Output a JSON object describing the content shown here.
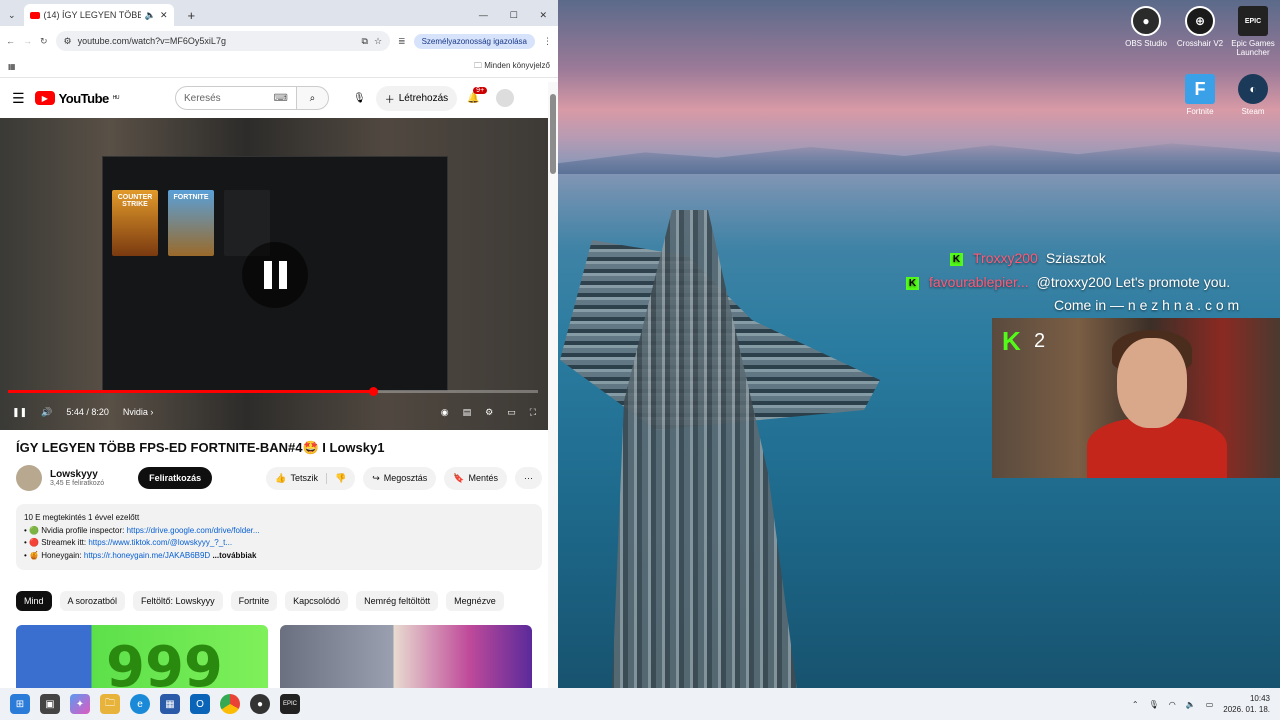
{
  "browser": {
    "tab_title": "(14) ÍGY LEGYEN TÖBB FPS-...",
    "url": "youtube.com/watch?v=MF6Oy5xiL7g",
    "profile_label": "Személyazonosság igazolása",
    "bookmarks_label": "Minden könyvjelző"
  },
  "youtube": {
    "logo_text": "YouTube",
    "logo_sup": "HU",
    "search_placeholder": "Keresés",
    "create_label": "Létrehozás",
    "notif_count": "9+",
    "player": {
      "time": "5:44 / 8:20",
      "chapter": "Nvidia",
      "progress_fraction": 0.688,
      "card_cs": "COUNTER STRIKE",
      "card_fn": "FORTNITE"
    },
    "video_title": "ÍGY LEGYEN TÖBB FPS-ED FORTNITE-BAN#4🤩 I Lowsky1",
    "channel_name": "Lowskyyy",
    "channel_subs": "3,45 E feliratkozó",
    "subscribe_label": "Feliratkozás",
    "like_label": "Tetszik",
    "share_label": "Megosztás",
    "save_label": "Mentés",
    "description": {
      "line1": "10 E megtekintés  1 évvel ezelőtt",
      "line2_prefix": "• 🟢 Nvidia profile inspector: ",
      "line2_link": "https://drive.google.com/drive/folder...",
      "line3_prefix": "• 🔴 Streamek itt: ",
      "line3_link": "https://www.tiktok.com/@lowskyyy_?_t...",
      "line4_prefix": "• 🍯 Honeygain: ",
      "line4_link": "https://r.honeygain.me/JAKAB6B9D",
      "more": "...továbbiak"
    },
    "chips": [
      "Mind",
      "A sorozatból",
      "Feltöltő: Lowskyyy",
      "Fortnite",
      "Kapcsolódó",
      "Nemrég feltöltött",
      "Megnézve"
    ],
    "thumb1_text": "999"
  },
  "desktop": {
    "icons": [
      {
        "label": "OBS Studio",
        "glyph": "●",
        "color": "#2b2b2b"
      },
      {
        "label": "Crosshair V2",
        "glyph": "⊕",
        "color": "#1a1a1a"
      },
      {
        "label": "Epic Games Launcher",
        "glyph": "EPIC",
        "color": "#222222"
      },
      {
        "label": "Fortnite",
        "glyph": "F",
        "color": "#3aa0e8"
      },
      {
        "label": "Steam",
        "glyph": "◐",
        "color": "#1b3a5a"
      }
    ],
    "chat": [
      {
        "user": "Troxxy200",
        "message": "Sziasztok"
      },
      {
        "user": "favourablepier...",
        "message": "@troxxy200 Let's promote you."
      },
      {
        "user": "",
        "message": "Come in — n e z h n a . c o m"
      }
    ],
    "webcam_count": "2"
  },
  "taskbar": {
    "time": "10:43",
    "date": "2026. 01. 18."
  }
}
